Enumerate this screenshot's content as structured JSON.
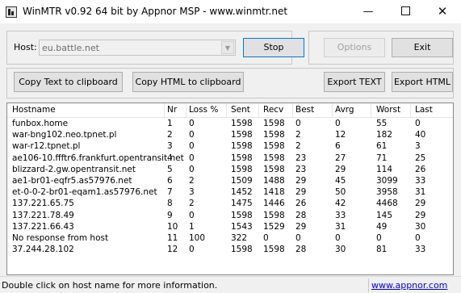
{
  "window": {
    "title": "WinMTR v0.92 64 bit by Appnor MSP - www.winmtr.net",
    "minimize_glyph": "—",
    "close_glyph": "✕"
  },
  "host": {
    "label": "Host:",
    "value": "eu.battle.net",
    "dropdown_glyph": "▼"
  },
  "buttons": {
    "stop": "Stop",
    "options": "Options",
    "exit": "Exit",
    "copy_text": "Copy Text to clipboard",
    "copy_html": "Copy HTML to clipboard",
    "export_text": "Export TEXT",
    "export_html": "Export HTML"
  },
  "table": {
    "columns": [
      "Hostname",
      "Nr",
      "Loss %",
      "Sent",
      "Recv",
      "Best",
      "Avrg",
      "Worst",
      "Last"
    ],
    "rows": [
      [
        "funbox.home",
        "1",
        "0",
        "1598",
        "1598",
        "0",
        "0",
        "55",
        "0"
      ],
      [
        "war-bng102.neo.tpnet.pl",
        "2",
        "0",
        "1598",
        "1598",
        "2",
        "12",
        "182",
        "40"
      ],
      [
        "war-r12.tpnet.pl",
        "3",
        "0",
        "1598",
        "1598",
        "2",
        "6",
        "61",
        "3"
      ],
      [
        "ae106-10.ffftr6.frankfurt.opentransit.net",
        "4",
        "0",
        "1598",
        "1598",
        "23",
        "27",
        "71",
        "25"
      ],
      [
        "blizzard-2.gw.opentransit.net",
        "5",
        "0",
        "1598",
        "1598",
        "23",
        "29",
        "114",
        "26"
      ],
      [
        "ae1-br01-eqfr5.as57976.net",
        "6",
        "2",
        "1509",
        "1488",
        "29",
        "45",
        "3099",
        "33"
      ],
      [
        "et-0-0-2-br01-eqam1.as57976.net",
        "7",
        "3",
        "1452",
        "1418",
        "29",
        "50",
        "3958",
        "31"
      ],
      [
        "137.221.65.75",
        "8",
        "2",
        "1475",
        "1446",
        "26",
        "42",
        "4468",
        "29"
      ],
      [
        "137.221.78.49",
        "9",
        "0",
        "1598",
        "1598",
        "28",
        "33",
        "145",
        "29"
      ],
      [
        "137.221.66.43",
        "10",
        "1",
        "1543",
        "1529",
        "29",
        "31",
        "49",
        "30"
      ],
      [
        "No response from host",
        "11",
        "100",
        "322",
        "0",
        "0",
        "0",
        "0",
        "0"
      ],
      [
        "37.244.28.102",
        "12",
        "0",
        "1598",
        "1598",
        "28",
        "30",
        "81",
        "33"
      ]
    ]
  },
  "status": {
    "text": "Double click on host name for more information.",
    "link": "www.appnor.com"
  }
}
